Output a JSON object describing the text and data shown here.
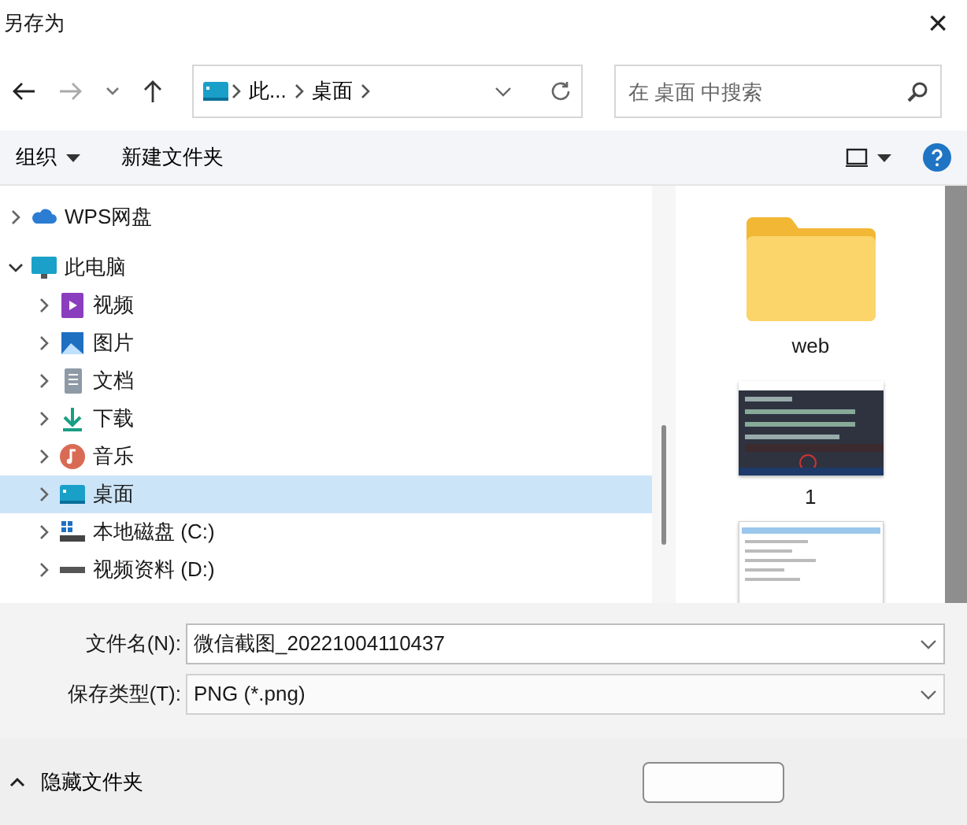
{
  "window": {
    "title": "另存为",
    "close": "×"
  },
  "nav": {
    "breadcrumb": [
      {
        "label": "此..."
      },
      {
        "label": "桌面"
      }
    ],
    "search": {
      "placeholder": "在 桌面 中搜索"
    }
  },
  "toolbar": {
    "buttons": [
      {
        "label": "组织",
        "dropdown": true
      },
      {
        "label": "新建文件夹",
        "dropdown": false
      }
    ]
  },
  "tree": [
    {
      "label": "WPS网盘",
      "kind": "cloud",
      "expanded": false,
      "selected": false
    },
    {
      "label": "此电脑",
      "kind": "pc",
      "expanded": true,
      "selected": false,
      "children": [
        {
          "label": "视频",
          "kind": "video",
          "expanded": false,
          "selected": false
        },
        {
          "label": "图片",
          "kind": "pictures",
          "expanded": false,
          "selected": false
        },
        {
          "label": "文档",
          "kind": "documents",
          "expanded": false,
          "selected": false
        },
        {
          "label": "下载",
          "kind": "downloads",
          "expanded": false,
          "selected": false
        },
        {
          "label": "音乐",
          "kind": "music",
          "expanded": false,
          "selected": false
        },
        {
          "label": "桌面",
          "kind": "desktop",
          "expanded": false,
          "selected": true
        },
        {
          "label": "本地磁盘 (C:)",
          "kind": "system-drive",
          "expanded": false,
          "selected": false
        },
        {
          "label": "视频资料 (D:)",
          "kind": "drive",
          "expanded": false,
          "selected": false
        }
      ]
    }
  ],
  "files": [
    {
      "label": "web",
      "kind": "folder"
    },
    {
      "label": "1",
      "kind": "picture"
    },
    {
      "kind": "picture"
    }
  ],
  "form": {
    "fields": [
      {
        "label": "文件名(N):",
        "value": "微信截图_20221004110437"
      },
      {
        "label": "保存类型(T):",
        "value": "PNG (*.png)"
      }
    ]
  },
  "footer": {
    "toggle": "隐藏文件夹"
  }
}
